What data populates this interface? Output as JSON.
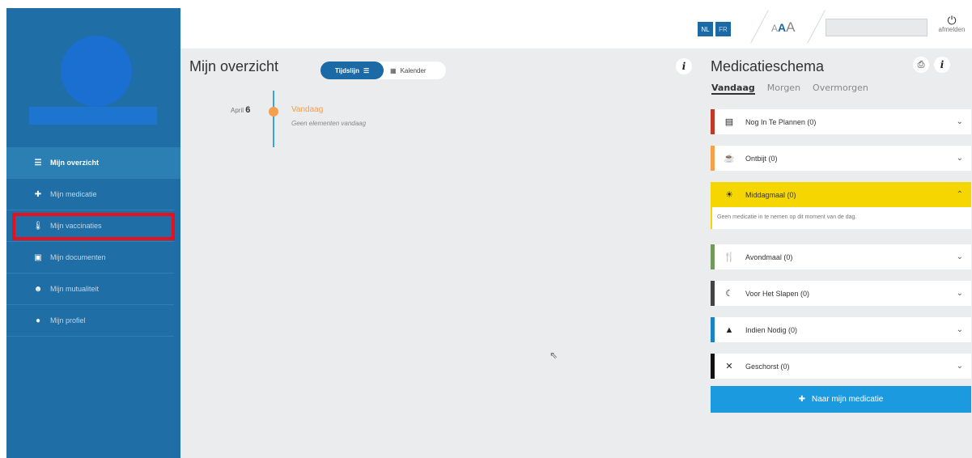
{
  "sidebar": {
    "items": [
      {
        "label": "Mijn overzicht",
        "icon": "list-icon",
        "active": true
      },
      {
        "label": "Mijn medicatie",
        "icon": "medical-kit-icon"
      },
      {
        "label": "Mijn vaccinaties",
        "icon": "thermometer-icon"
      },
      {
        "label": "Mijn documenten",
        "icon": "document-icon"
      },
      {
        "label": "Mijn mutualiteit",
        "icon": "hand-user-icon"
      },
      {
        "label": "Mijn profiel",
        "icon": "user-icon"
      }
    ],
    "highlight_color": "#e8111b",
    "bg_color": "#1f6ea6"
  },
  "topbar": {
    "lang_nl": "NL",
    "lang_fr": "FR",
    "font_small": "A",
    "font_medium": "A",
    "font_large": "A",
    "logout_label": "afmelden"
  },
  "main": {
    "title": "Mijn overzicht",
    "view_timeline": "Tijdslijn",
    "view_calendar": "Kalender",
    "timeline": {
      "month": "April",
      "day": "6",
      "title": "Vandaag",
      "subtitle": "Geen elementen vandaag"
    }
  },
  "schedule": {
    "title": "Medicatieschema",
    "tabs": [
      "Vandaag",
      "Morgen",
      "Overmorgen"
    ],
    "sections": [
      {
        "label": "Nog In Te Plannen (0)",
        "icon": "list-box-icon",
        "color": "#c0392b"
      },
      {
        "label": "Ontbijt (0)",
        "icon": "coffee-icon",
        "color": "#f5a04d"
      },
      {
        "label": "Middagmaal (0)",
        "icon": "sun-icon",
        "color": "#f6d600",
        "open": true
      },
      {
        "label": "Avondmaal (0)",
        "icon": "cutlery-icon",
        "color": "#6f9a5c"
      },
      {
        "label": "Voor Het Slapen (0)",
        "icon": "moon-icon",
        "color": "#444444"
      },
      {
        "label": "Indien Nodig (0)",
        "icon": "warning-icon",
        "color": "#1b82c4"
      },
      {
        "label": "Geschorst (0)",
        "icon": "x-icon",
        "color": "#111111"
      }
    ],
    "open_message": "Geen medicatie in te nemen op dit moment van de dag.",
    "cta_label": "Naar mijn medicatie"
  }
}
